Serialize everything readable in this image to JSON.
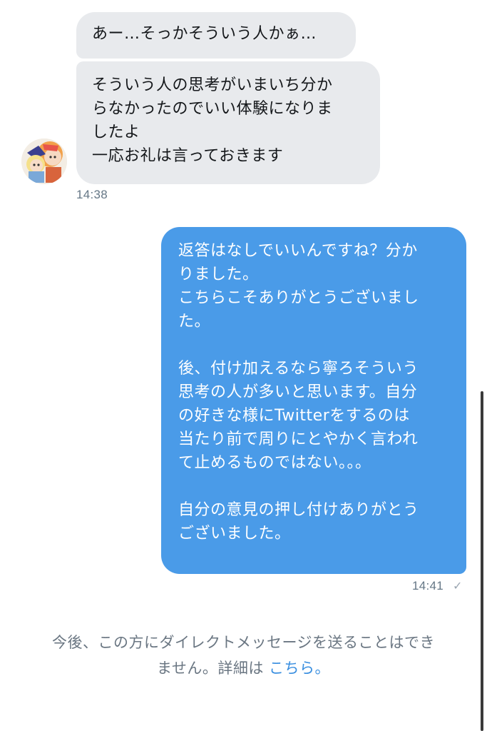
{
  "messages": {
    "incoming": [
      {
        "text": "あー…そっかそういう人かぁ…"
      },
      {
        "text": "そういう人の思考がいまいち分か\nらなかったのでいい体験になりま\nしたよ\n一応お礼は言っておきます"
      }
    ],
    "incoming_time": "14:38",
    "outgoing": [
      {
        "text": "返答はなしでいいんですね？分か\nりました。\nこちらこそありがとうございまし\nた。\n\n後、付け加えるなら寧ろそういう\n思考の人が多いと思います。自分\nの好きな様にTwitterをするのは\n当たり前で周りにとやかく言われ\nて止めるものではない。。。\n\n自分の意見の押し付けありがとう\nございました。"
      }
    ],
    "outgoing_time": "14:41",
    "read_icon": "check-icon"
  },
  "notice": {
    "line1": "今後、この方にダイレクトメッセージを送ることはでき",
    "line2": "ません。詳細は",
    "link": "こちら",
    "end": "。"
  },
  "colors": {
    "incoming_bubble": "#e8eaed",
    "outgoing_bubble": "#4a9be8",
    "link": "#3a8fe0"
  }
}
